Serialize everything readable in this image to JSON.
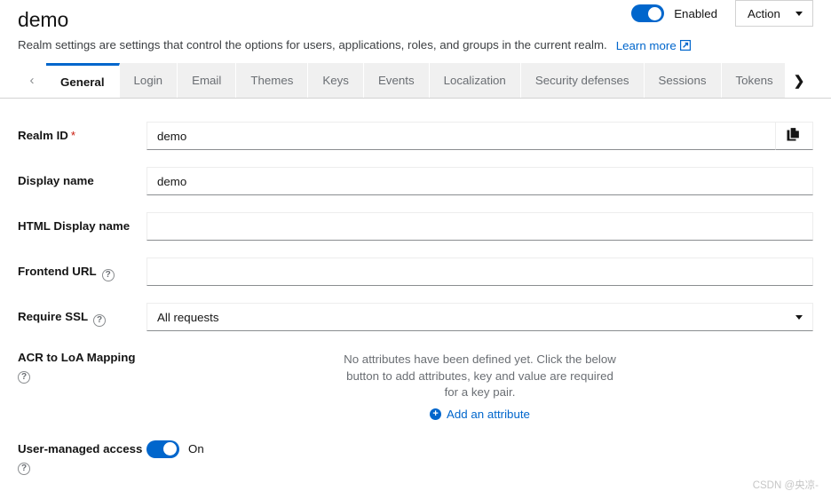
{
  "header": {
    "title": "demo",
    "subtitle": "Realm settings are settings that control the options for users, applications, roles, and groups in the current realm.",
    "learn_more_label": "Learn more",
    "learn_more_icon": "external-link-icon",
    "enabled_label": "Enabled",
    "enabled_state": "on",
    "action_label": "Action",
    "action_caret_icon": "caret-down-icon"
  },
  "tabs": {
    "scroll_left_icon": "chevron-left-icon",
    "scroll_right_icon": "chevron-right-icon",
    "items": [
      {
        "label": "General"
      },
      {
        "label": "Login"
      },
      {
        "label": "Email"
      },
      {
        "label": "Themes"
      },
      {
        "label": "Keys"
      },
      {
        "label": "Events"
      },
      {
        "label": "Localization"
      },
      {
        "label": "Security defenses"
      },
      {
        "label": "Sessions"
      },
      {
        "label": "Tokens"
      }
    ],
    "active": "General"
  },
  "form": {
    "realm_id": {
      "label": "Realm ID",
      "required_marker": "*",
      "value": "demo",
      "placeholder": "",
      "copy_icon": "copy-icon"
    },
    "display_name": {
      "label": "Display name",
      "value": "demo",
      "placeholder": ""
    },
    "html_display_name": {
      "label": "HTML Display name",
      "value": "",
      "placeholder": ""
    },
    "frontend_url": {
      "label": "Frontend URL",
      "help_icon": "help-icon",
      "value": "",
      "placeholder": ""
    },
    "require_ssl": {
      "label": "Require SSL",
      "help_icon": "help-icon",
      "value": "All requests",
      "caret_icon": "caret-down-icon"
    },
    "acr_to_loa": {
      "label": "ACR to LoA Mapping",
      "help_icon": "help-icon",
      "empty_text": "No attributes have been defined yet. Click the below button to add attributes, key and value are required for a key pair.",
      "add_label": "Add an attribute",
      "add_icon": "plus-circle-icon"
    },
    "user_managed_access": {
      "label": "User-managed access",
      "help_icon": "help-icon",
      "state_label": "On",
      "state": "on"
    }
  },
  "watermark": {
    "text": "CSDN @央凉-"
  },
  "colors": {
    "accent": "#0066cc",
    "required": "#c9190b",
    "text": "#151515",
    "muted": "#6a6e73",
    "tab_bg": "#f0f0f0"
  }
}
